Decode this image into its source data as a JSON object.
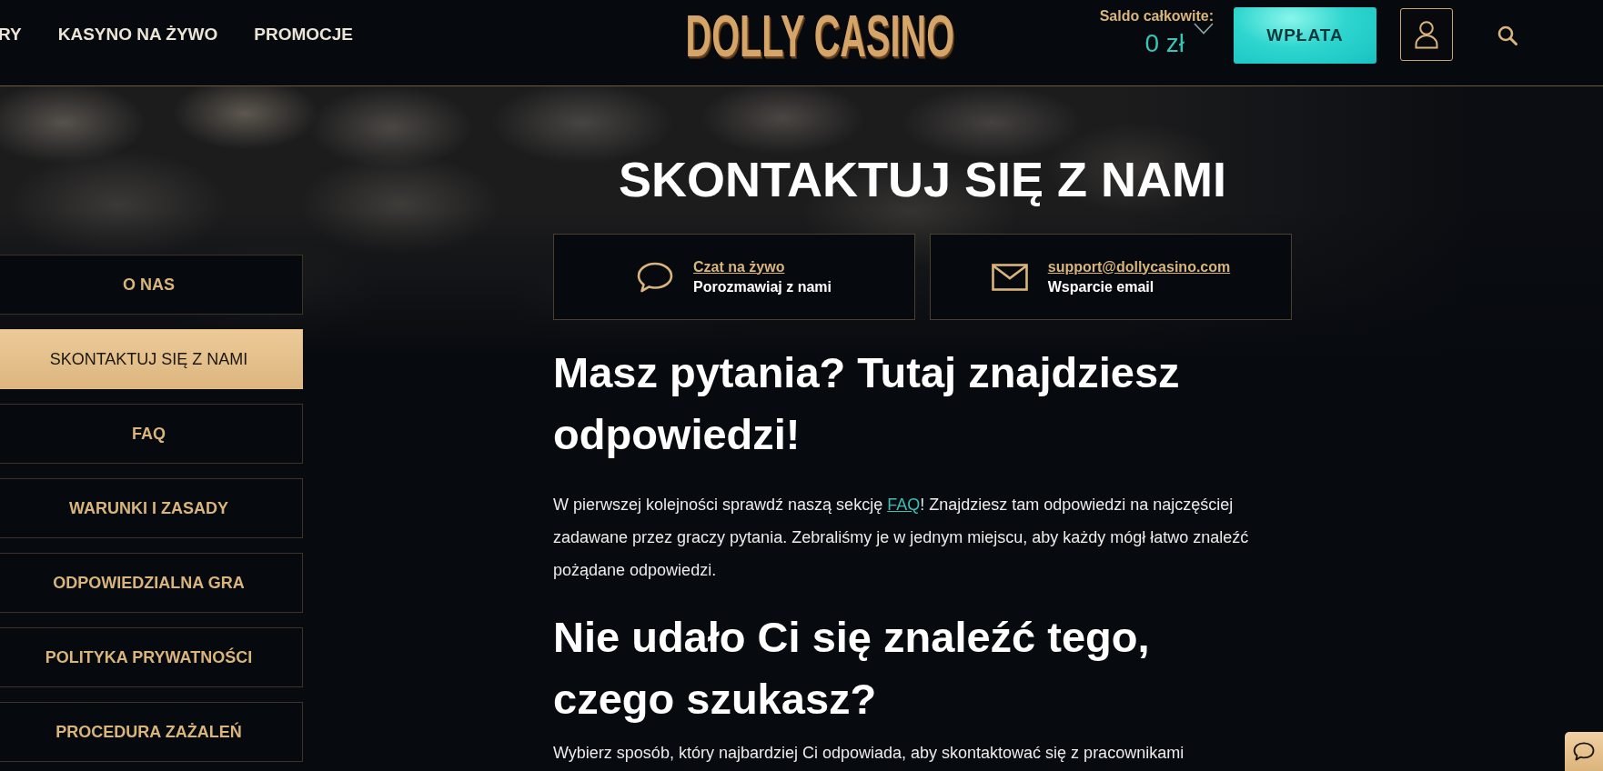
{
  "header": {
    "nav": [
      {
        "label": "RY"
      },
      {
        "label": "KASYNO NA ŻYWO"
      },
      {
        "label": "PROMOCJE"
      }
    ],
    "logo": "DOLLY CASINO",
    "balance": {
      "label": "Saldo całkowite:",
      "amount": "0 zł"
    },
    "deposit_button": "WPŁATA"
  },
  "page_title": "SKONTAKTUJ SIĘ Z NAMI",
  "contact_cards": [
    {
      "kind": "chat",
      "link": "Czat na żywo",
      "caption": "Porozmawiaj z nami"
    },
    {
      "kind": "email",
      "link": "support@dollycasino.com",
      "caption": "Wsparcie email"
    }
  ],
  "sidebar": {
    "items": [
      {
        "label": "O NAS",
        "selected": false
      },
      {
        "label": "SKONTAKTUJ SIĘ Z NAMI",
        "selected": true
      },
      {
        "label": "FAQ",
        "selected": false
      },
      {
        "label": "WARUNKI I ZASADY",
        "selected": false
      },
      {
        "label": "ODPOWIEDZIALNA GRA",
        "selected": false
      },
      {
        "label": "POLITYKA PRYWATNOŚCI",
        "selected": false
      },
      {
        "label": "PROCEDURA ZAŻALEŃ",
        "selected": false
      }
    ]
  },
  "content": [
    {
      "kind": "heading",
      "text": "Masz pytania? Tutaj znajdziesz odpowiedzi!"
    },
    {
      "kind": "paragraph",
      "parts": [
        {
          "kind": "text",
          "text": "W pierwszej kolejności sprawdź naszą sekcję "
        },
        {
          "kind": "link",
          "text": "FAQ"
        },
        {
          "kind": "text",
          "text": "! Znajdziesz tam odpowiedzi na najczęściej zadawane przez graczy pytania. Zebraliśmy je w jednym miejscu, aby każdy mógł łatwo znaleźć pożądane odpowiedzi."
        }
      ]
    },
    {
      "kind": "heading",
      "text": "Nie udało Ci się znaleźć tego, czego szukasz?"
    },
    {
      "kind": "paragraph",
      "parts": [
        {
          "kind": "text",
          "text": "Wybierz sposób, który najbardziej Ci odpowiada, aby skontaktować się z pracownikami"
        }
      ]
    }
  ]
}
